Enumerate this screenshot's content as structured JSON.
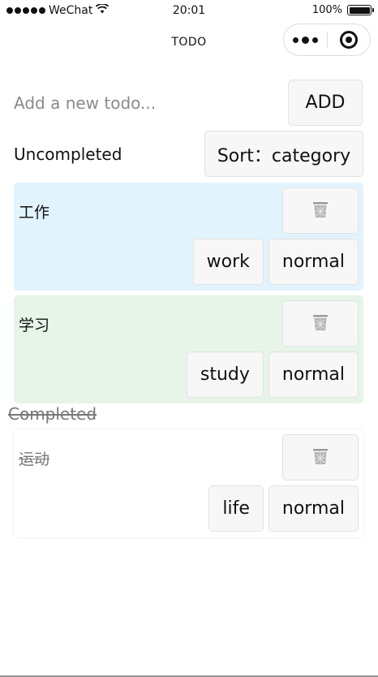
{
  "status_bar": {
    "carrier": "WeChat",
    "time": "20:01",
    "battery_percent": "100%",
    "battery_level": 1.0
  },
  "nav": {
    "title": "TODO"
  },
  "input": {
    "placeholder": "Add a new todo...",
    "value": ""
  },
  "add_button": {
    "label": "ADD"
  },
  "uncompleted": {
    "label": "Uncompleted",
    "sort_label": "Sort：category",
    "items": [
      {
        "name": "工作",
        "category": "work",
        "priority": "normal",
        "color": "#e1f3fd"
      },
      {
        "name": "学习",
        "category": "study",
        "priority": "normal",
        "color": "#e7f5e9"
      }
    ]
  },
  "completed": {
    "label": "Completed",
    "items": [
      {
        "name": "运动",
        "category": "life",
        "priority": "normal",
        "color": "#ffffff"
      }
    ]
  },
  "icons": {
    "delete": "trash-icon",
    "more": "more-dots-icon",
    "close": "close-capsule-icon"
  }
}
